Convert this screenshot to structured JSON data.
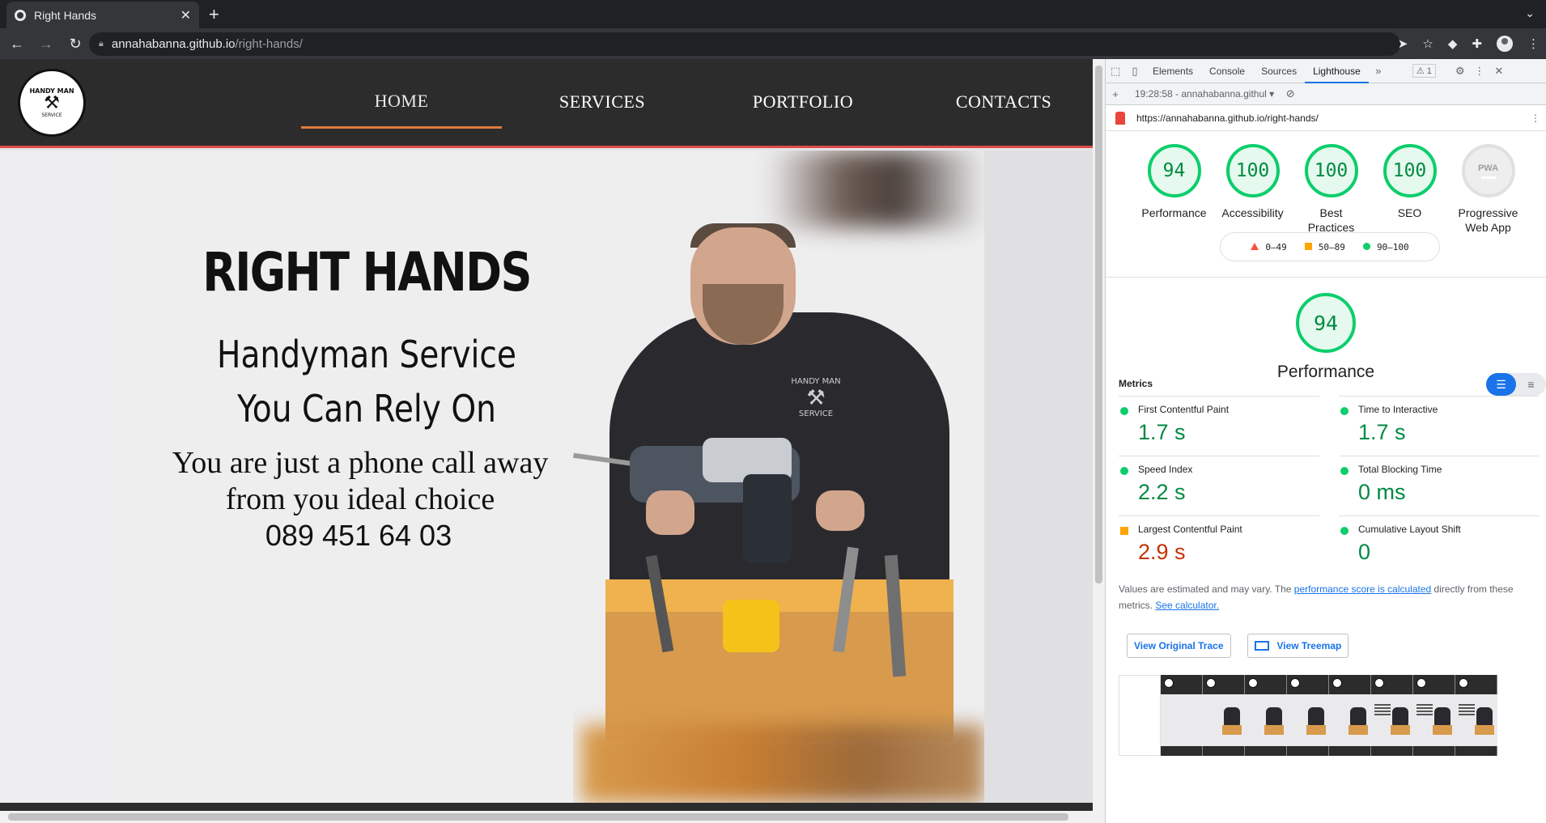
{
  "browser": {
    "tab_title": "Right Hands",
    "url_host": "annahabanna.github.io",
    "url_path": "/right-hands/"
  },
  "site": {
    "logo_top": "HANDY MAN",
    "logo_bottom": "SERVICE",
    "nav": [
      {
        "label": "HOME",
        "active": true
      },
      {
        "label": "SERVICES",
        "active": false
      },
      {
        "label": "PORTFOLIO",
        "active": false
      },
      {
        "label": "CONTACTS",
        "active": false
      }
    ],
    "hero": {
      "brand": "RIGHT HANDS",
      "tagline_1": "Handyman Service",
      "tagline_2": "You Can Rely On",
      "call_text_1": "You are just a phone call away",
      "call_text_2": "from you ideal choice",
      "phone": "089 451 64 03",
      "hoodie_logo_top": "HANDY MAN",
      "hoodie_logo_bottom": "SERVICE"
    }
  },
  "devtools": {
    "tabs": [
      "Elements",
      "Console",
      "Sources",
      "Lighthouse"
    ],
    "active_tab": "Lighthouse",
    "warning_count": "1",
    "report_select": "19:28:58 - annahabanna.githul",
    "report_url": "https://annahabanna.github.io/right-hands/",
    "scores": [
      {
        "label": "Performance",
        "value": "94"
      },
      {
        "label": "Accessibility",
        "value": "100"
      },
      {
        "label": "Best Practices",
        "value": "100"
      },
      {
        "label": "SEO",
        "value": "100"
      },
      {
        "label": "Progressive Web App",
        "value": "PWA"
      }
    ],
    "legend": {
      "fail": "0–49",
      "average": "50–89",
      "pass": "90–100"
    },
    "main_score": {
      "value": "94",
      "label": "Performance"
    },
    "metrics_title": "Metrics",
    "metrics": [
      {
        "name": "First Contentful Paint",
        "value": "1.7 s",
        "status": "pass"
      },
      {
        "name": "Time to Interactive",
        "value": "1.7 s",
        "status": "pass"
      },
      {
        "name": "Speed Index",
        "value": "2.2 s",
        "status": "pass"
      },
      {
        "name": "Total Blocking Time",
        "value": "0 ms",
        "status": "pass"
      },
      {
        "name": "Largest Contentful Paint",
        "value": "2.9 s",
        "status": "average"
      },
      {
        "name": "Cumulative Layout Shift",
        "value": "0",
        "status": "pass"
      }
    ],
    "note_prefix": "Values are estimated and may vary. The ",
    "note_link": "performance score is calculated",
    "note_mid": " directly from these metrics. ",
    "note_link2": "See calculator.",
    "btn_trace": "View Original Trace",
    "btn_treemap": "View Treemap",
    "colors": {
      "pass": "#0cce6b",
      "average": "#ffa400",
      "fail": "#ff4e42"
    }
  }
}
